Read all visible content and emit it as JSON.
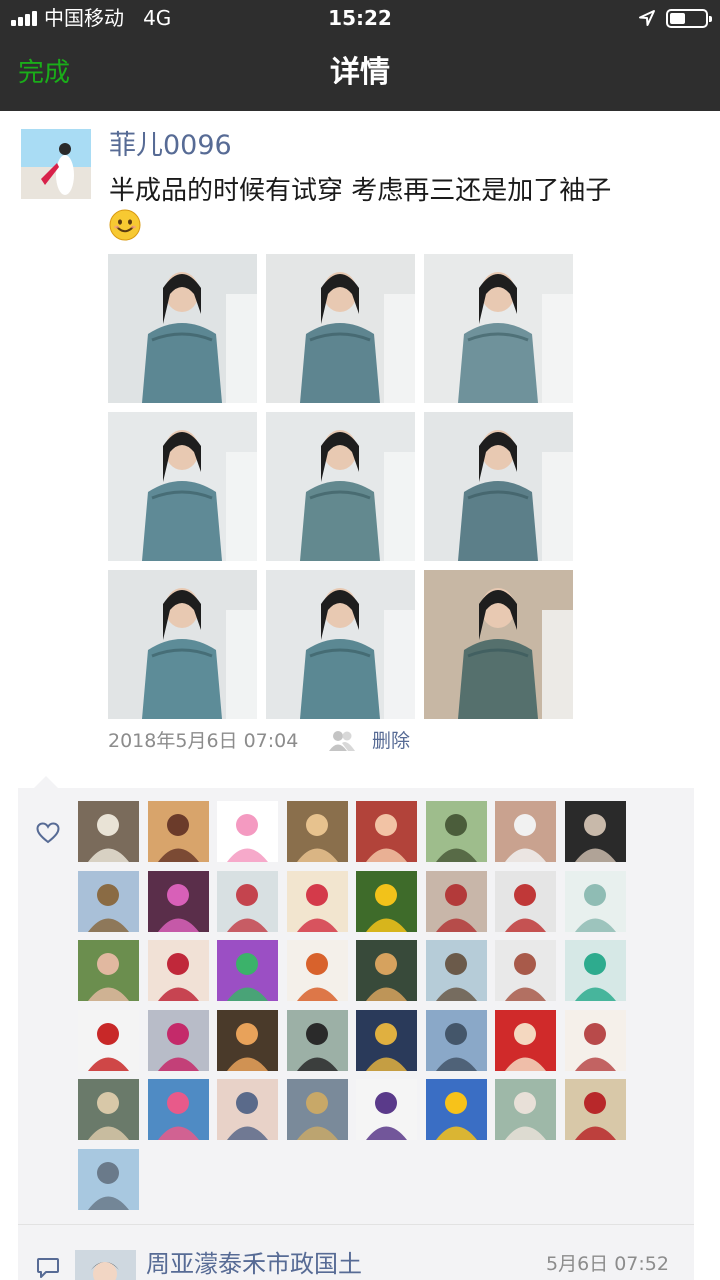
{
  "status_bar": {
    "carrier": "中国移动",
    "network": "4G",
    "time": "15:22",
    "battery_level": 0.45,
    "signal_bars": 4
  },
  "nav": {
    "done_label": "完成",
    "title": "详情"
  },
  "post": {
    "author": "菲儿0096",
    "text": "半成品的时候有试穿 考虑再三还是加了袖子",
    "emoji": "smile-emoji",
    "photos": [
      {
        "name": "lace-yoke-closeup",
        "bg": "#dfe3e4",
        "fg": "#5c8793"
      },
      {
        "name": "standing-jeans",
        "bg": "#e4e6e6",
        "fg": "#5e8590"
      },
      {
        "name": "standing-pink-skirt",
        "bg": "#e8eaea",
        "fg": "#6f929b"
      },
      {
        "name": "smiling-closeup",
        "bg": "#e6e9ea",
        "fg": "#5f8a96"
      },
      {
        "name": "leaning-handbag",
        "bg": "#e5e8e9",
        "fg": "#63898f"
      },
      {
        "name": "floral-skirt-handbag",
        "bg": "#e3e6e7",
        "fg": "#5c7f89"
      },
      {
        "name": "short-sleeve-side",
        "bg": "#e1e4e5",
        "fg": "#5d8c98"
      },
      {
        "name": "short-sleeve-front",
        "bg": "#e4e7e8",
        "fg": "#5b8893"
      },
      {
        "name": "sleeve-on-blanket",
        "bg": "#c7b7a4",
        "fg": "#55706d"
      }
    ],
    "time": "2018年5月6日 07:04",
    "visibility_icon": "people-icon",
    "delete_label": "删除"
  },
  "likes": {
    "icon": "heart-icon",
    "avatars": [
      {
        "bg": "#7a6b5b",
        "fg": "#e9e3d6"
      },
      {
        "bg": "#d8a46b",
        "fg": "#6b3b2a"
      },
      {
        "bg": "#ffffff",
        "fg": "#f49ac1"
      },
      {
        "bg": "#8a6f4c",
        "fg": "#e7c28e"
      },
      {
        "bg": "#b2433a",
        "fg": "#f2c3a5"
      },
      {
        "bg": "#9ebd8c",
        "fg": "#4b5d3b"
      },
      {
        "bg": "#c9a28f",
        "fg": "#f1f1f1"
      },
      {
        "bg": "#2a2a2a",
        "fg": "#c8b9aa"
      },
      {
        "bg": "#a9c0d8",
        "fg": "#8a6b44"
      },
      {
        "bg": "#5a2e4a",
        "fg": "#d860b8"
      },
      {
        "bg": "#d8e0e2",
        "fg": "#c4444e"
      },
      {
        "bg": "#f2e5cf",
        "fg": "#d43a4a"
      },
      {
        "bg": "#3e6b2a",
        "fg": "#f2c21a"
      },
      {
        "bg": "#c8b6a9",
        "fg": "#b33a3a"
      },
      {
        "bg": "#e5e5e5",
        "fg": "#c03838"
      },
      {
        "bg": "#e8f0ee",
        "fg": "#8fbcb4"
      },
      {
        "bg": "#6b8e4e",
        "fg": "#e1b8a0"
      },
      {
        "bg": "#f1e1d6",
        "fg": "#c0283a"
      },
      {
        "bg": "#9b4fc4",
        "fg": "#3bb26a"
      },
      {
        "bg": "#f4f0ea",
        "fg": "#d8622c"
      },
      {
        "bg": "#384a3a",
        "fg": "#d6a25e"
      },
      {
        "bg": "#b6ccd8",
        "fg": "#6b5a4a"
      },
      {
        "bg": "#e9e9e9",
        "fg": "#a85a4a"
      },
      {
        "bg": "#d6e8e6",
        "fg": "#2eab8e"
      },
      {
        "bg": "#f4f4f4",
        "fg": "#c82828"
      },
      {
        "bg": "#b8bcc8",
        "fg": "#c42a6a"
      },
      {
        "bg": "#4a3a2a",
        "fg": "#e8a25a"
      },
      {
        "bg": "#9cb0a6",
        "fg": "#2a2a2a"
      },
      {
        "bg": "#2a3a5a",
        "fg": "#e0b040"
      },
      {
        "bg": "#8aa8c8",
        "fg": "#44566a"
      },
      {
        "bg": "#d02a2a",
        "fg": "#f4d8c0"
      },
      {
        "bg": "#f5f0ea",
        "fg": "#b84a4a"
      },
      {
        "bg": "#6a7a6a",
        "fg": "#d8c8a8"
      },
      {
        "bg": "#4f8bc4",
        "fg": "#e85a8a"
      },
      {
        "bg": "#e8d2c8",
        "fg": "#5a6a8a"
      },
      {
        "bg": "#7a8a9a",
        "fg": "#c8a868"
      },
      {
        "bg": "#f5f5f5",
        "fg": "#5a3a8a"
      },
      {
        "bg": "#3a6ec4",
        "fg": "#f7c21a"
      },
      {
        "bg": "#9eb8a8",
        "fg": "#e8e0d8"
      },
      {
        "bg": "#d8c8a8",
        "fg": "#b8282a"
      },
      {
        "bg": "#a8c8e0",
        "fg": "#6a7a8a"
      }
    ]
  },
  "comment": {
    "icon": "comment-icon",
    "author": "周亚濛泰禾市政国土",
    "time": "5月6日 07:52"
  }
}
